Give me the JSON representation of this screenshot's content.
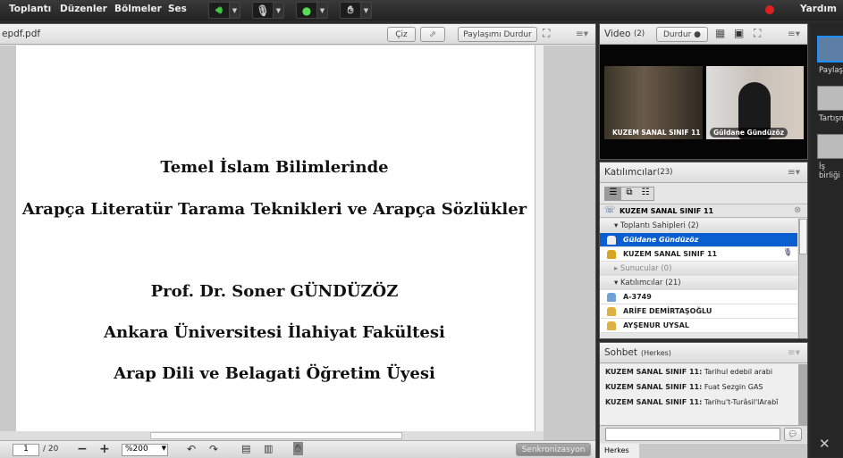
{
  "menu": {
    "items": [
      "Toplantı",
      "Düzenler",
      "Bölmeler",
      "Ses"
    ],
    "help": "Yardım",
    "record_color": "#e02020"
  },
  "toolbar_icons": [
    "speaker-icon",
    "microphone-icon",
    "webcam-icon",
    "raise-hand-icon"
  ],
  "share_pod": {
    "file": "epdf.pdf",
    "draw": "Çiz",
    "stop_share": "Paylaşımı Durdur",
    "slide_lines": [
      "Temel İslam Bilimlerinde",
      "Arapça Literatür Tarama Teknikleri ve Arapça Sözlükler",
      "Prof. Dr. Soner GÜNDÜZÖZ",
      "Ankara Üniversitesi İlahiyat Fakültesi",
      "Arap Dili ve Belagati Öğretim Üyesi"
    ],
    "page": "1",
    "total": "/ 20",
    "zoom": "%200",
    "sync": "Senkronizasyon"
  },
  "video": {
    "title": "Video",
    "count": "(2)",
    "stop": "Durdur",
    "feeds": [
      "KUZEM SANAL SINIF 11",
      "Güldane Gündüzöz"
    ]
  },
  "attendees": {
    "title": "Katılımcılar",
    "count": "(23)",
    "me": "KUZEM SANAL SINIF 11",
    "hosts_label": "Toplantı Sahipleri (2)",
    "hosts": [
      "Güldane Gündüzöz",
      "KUZEM SANAL SINIF 11"
    ],
    "presenters_label": "Sunucular (0)",
    "participants_label": "Katılımcılar (21)",
    "participants": [
      "A-3749",
      "ARİFE DEMİRTAŞOĞLU",
      "AYŞENUR UYSAL"
    ],
    "selected_color": "#0a5fd0"
  },
  "chat": {
    "title": "Sohbet",
    "scope": "(Herkes)",
    "tab": "Herkes",
    "messages": [
      {
        "from": "KUZEM SANAL SINIF 11:",
        "text": "Tarihul edebil arabi"
      },
      {
        "from": "KUZEM SANAL SINIF 11:",
        "text": "Fuat Sezgin GAS"
      },
      {
        "from": "KUZEM SANAL SINIF 11:",
        "text": "Tarihu't-Turâsil'lArabî"
      }
    ]
  },
  "layouts": [
    "Paylaşım",
    "Tartışma",
    "İş birliği"
  ]
}
